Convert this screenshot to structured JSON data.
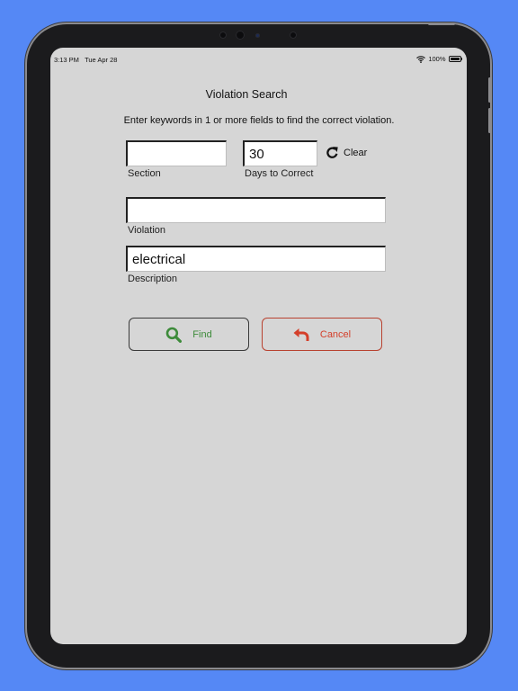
{
  "status_bar": {
    "time": "3:13 PM",
    "date": "Tue Apr 28",
    "battery": "100%",
    "icons": [
      "wifi-icon",
      "battery-icon"
    ]
  },
  "title": "Violation Search",
  "instructions": "Enter keywords in 1 or more fields to find the correct violation.",
  "fields": {
    "section": {
      "label": "Section",
      "value": ""
    },
    "days": {
      "label": "Days to Correct",
      "value": "30"
    },
    "violation": {
      "label": "Violation",
      "value": ""
    },
    "description": {
      "label": "Description",
      "value": "electrical"
    }
  },
  "clear": {
    "label": "Clear",
    "icon": "refresh-icon"
  },
  "buttons": {
    "find": {
      "label": "Find",
      "icon": "search-icon",
      "color": "#3d8b3a"
    },
    "cancel": {
      "label": "Cancel",
      "icon": "undo-arrow-icon",
      "color": "#d43f2a"
    }
  },
  "colors": {
    "background": "#5588f5",
    "screen": "#d6d6d6",
    "device": "#1b1b1d"
  }
}
